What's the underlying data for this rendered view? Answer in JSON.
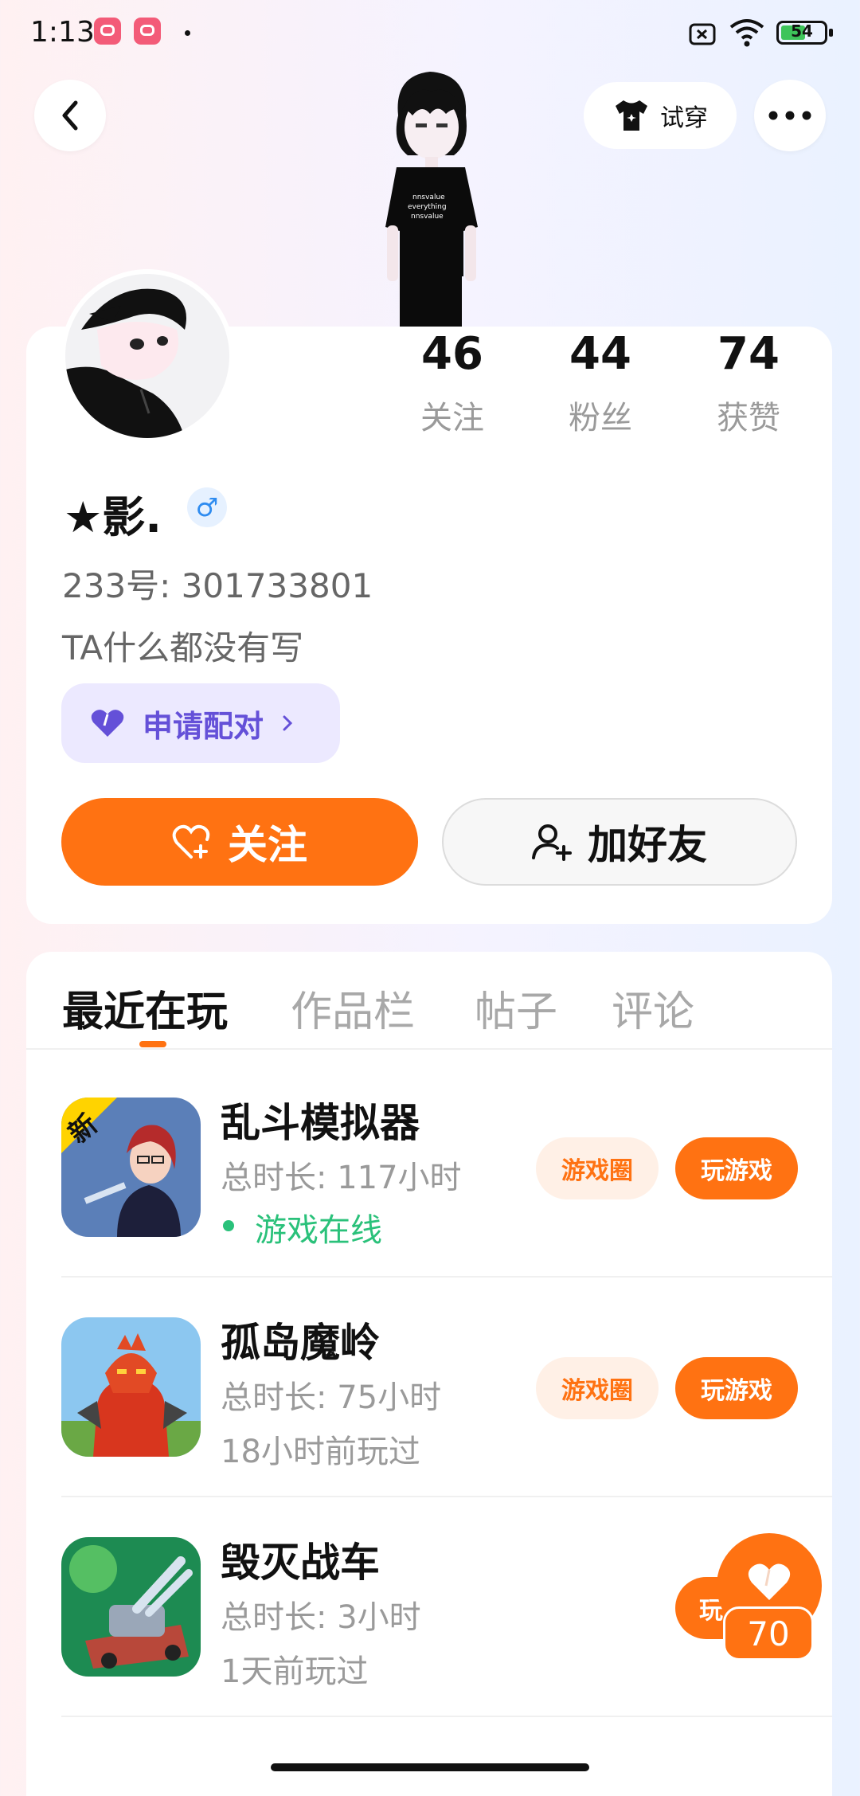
{
  "status_bar": {
    "time": "1:13",
    "battery": "54"
  },
  "header": {
    "back_icon": "chevron-left-icon",
    "tryon_label": "试穿",
    "more_icon": "more-horizontal-icon"
  },
  "profile": {
    "stats": [
      {
        "value": "46",
        "label": "关注"
      },
      {
        "value": "44",
        "label": "粉丝"
      },
      {
        "value": "74",
        "label": "获赞"
      }
    ],
    "nickname": "★影.",
    "gender_symbol": "♂",
    "id_line": "233号: 301733801",
    "bio": "TA什么都没有写",
    "pair_label": "申请配对",
    "follow_label": "关注",
    "add_friend_label": "加好友"
  },
  "tabs": [
    {
      "label": "最近在玩"
    },
    {
      "label": "作品栏"
    },
    {
      "label": "帖子"
    },
    {
      "label": "评论"
    }
  ],
  "games": [
    {
      "title": "乱斗模拟器",
      "duration": "总时长: 117小时",
      "status": "游戏在线",
      "online": true,
      "circle_label": "游戏圈",
      "play_label": "玩游戏"
    },
    {
      "title": "孤岛魔岭",
      "duration": "总时长: 75小时",
      "status": "18小时前玩过",
      "online": false,
      "circle_label": "游戏圈",
      "play_label": "玩游戏"
    },
    {
      "title": "毁灭战车",
      "duration": "总时长: 3小时",
      "status": "1天前玩过",
      "online": false,
      "circle_label": "",
      "play_label": "玩"
    }
  ],
  "like_float": {
    "count": "70"
  },
  "colors": {
    "accent": "#ff7212",
    "pair_bg": "#ece9ff",
    "pair_text": "#6450d8",
    "online": "#2ac17a"
  }
}
